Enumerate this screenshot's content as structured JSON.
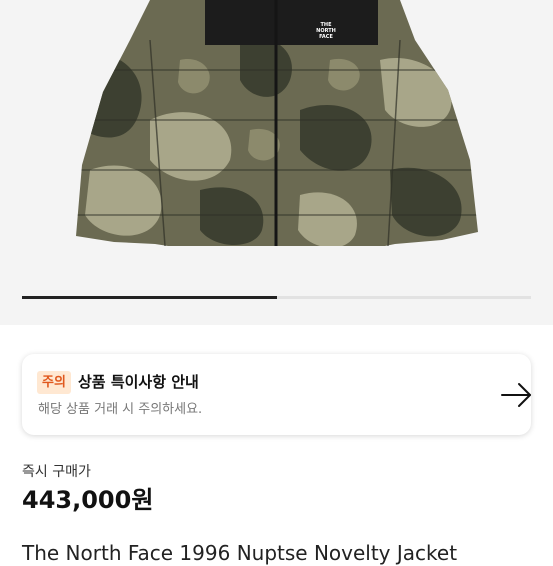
{
  "gallery": {
    "image_alt": "camouflage puffer jacket",
    "brand_logo_lines": [
      "THE",
      "NORTH",
      "FACE"
    ],
    "indicator_progress": 0.5
  },
  "notice": {
    "badge": "주의",
    "title": "상품 특이사항 안내",
    "description": "해당 상품 거래 시 주의하세요."
  },
  "price": {
    "label": "즉시 구매가",
    "value": "443,000원"
  },
  "product": {
    "title": "The North Face 1996 Nuptse Novelty Jacket"
  },
  "icons": {
    "notice_arrow": "arrow-right-icon"
  },
  "colors": {
    "badge_bg": "#ffe8d2",
    "badge_text": "#e0581d",
    "camo_base": "#6b6a52",
    "camo_dark": "#3d4031",
    "camo_light": "#a8a689"
  }
}
